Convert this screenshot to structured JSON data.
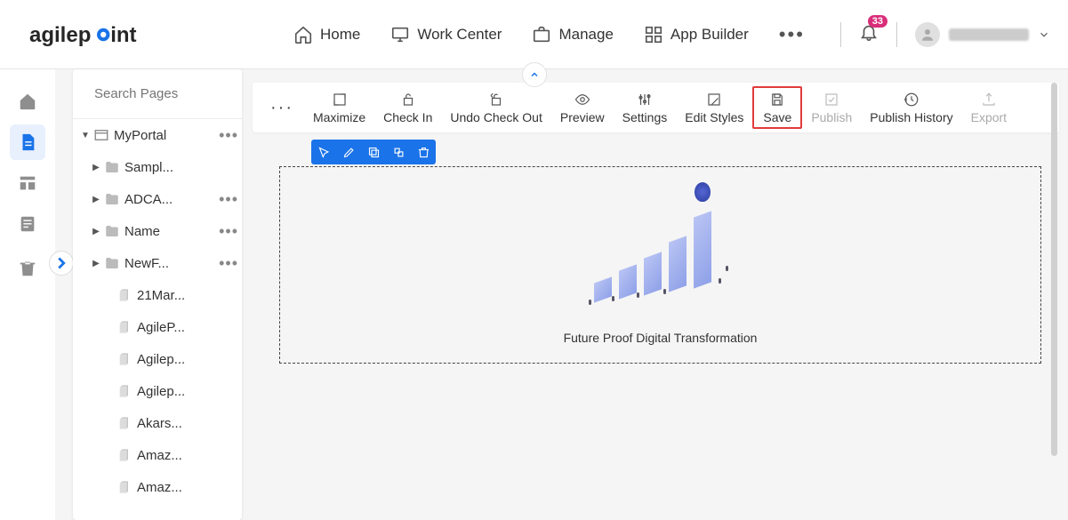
{
  "header": {
    "brand": "agilepoint",
    "nav": {
      "home": "Home",
      "work_center": "Work Center",
      "manage": "Manage",
      "app_builder": "App Builder"
    },
    "notification_count": "33",
    "username": "Murali"
  },
  "sidebar": {
    "items": [
      "home",
      "pages",
      "layouts",
      "templates",
      "trash"
    ]
  },
  "panel": {
    "search_placeholder": "Search Pages",
    "root": "MyPortal",
    "folders": [
      "Sampl...",
      "ADCA...",
      "Name",
      "NewF..."
    ],
    "pages": [
      "21Mar...",
      "AgileP...",
      "Agilep...",
      "Agilep...",
      "Akars...",
      "Amaz...",
      "Amaz..."
    ]
  },
  "toolbar": {
    "maximize": "Maximize",
    "check_in": "Check In",
    "undo_checkout": "Undo Check Out",
    "preview": "Preview",
    "settings": "Settings",
    "edit_styles": "Edit Styles",
    "save": "Save",
    "publish": "Publish",
    "publish_history": "Publish History",
    "export": "Export"
  },
  "widget": {
    "caption": "Future Proof Digital Transformation"
  }
}
